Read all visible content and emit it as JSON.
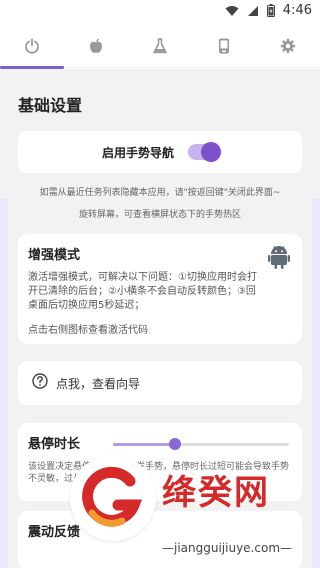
{
  "status_bar": {
    "time": "4:46",
    "icons": [
      "wifi-icon",
      "signal-icon",
      "battery-icon"
    ]
  },
  "tabs": [
    {
      "id": "power",
      "icon": "power-icon",
      "active": true
    },
    {
      "id": "apple",
      "icon": "apple-icon",
      "active": false
    },
    {
      "id": "lab",
      "icon": "flask-icon",
      "active": false
    },
    {
      "id": "device",
      "icon": "phone-icon",
      "active": false
    },
    {
      "id": "settings",
      "icon": "gear-icon",
      "active": false
    }
  ],
  "colors": {
    "accent": "#7b52c9",
    "accent_light": "#c6b4ee",
    "background": "#f2f2f2",
    "card": "#ffffff",
    "watermark_red": "#d62a2a"
  },
  "section_title": "基础设置",
  "gesture_nav": {
    "label": "启用手势导航",
    "enabled": true
  },
  "notices": [
    "如需从最近任务列表隐藏本应用，请\"按返回键\"关闭此界面~",
    "旋转屏幕，可查看横屏状态下的手势热区"
  ],
  "enhance_mode": {
    "title": "增强模式",
    "description": "激活增强模式，可解决以下问题：①切换应用时会打开已清除的后台；②小横条不会自动反转颜色；③回桌面后切换应用5秒延迟；",
    "hint": "点击右侧图标查看激活代码",
    "icon": "android-icon"
  },
  "guide": {
    "icon": "help-icon",
    "label": "点我，查看向导"
  },
  "hover_duration": {
    "title": "悬停时长",
    "slider_value": 0.35,
    "description": "该设置决定悬停多久才算触发手势，悬停时长过短可能会导致手势不灵敏，过长则操作不流畅"
  },
  "vibration": {
    "title": "震动反馈"
  },
  "watermark": {
    "title": "绛癸网",
    "url": "—jiangguijiuye.com—"
  }
}
